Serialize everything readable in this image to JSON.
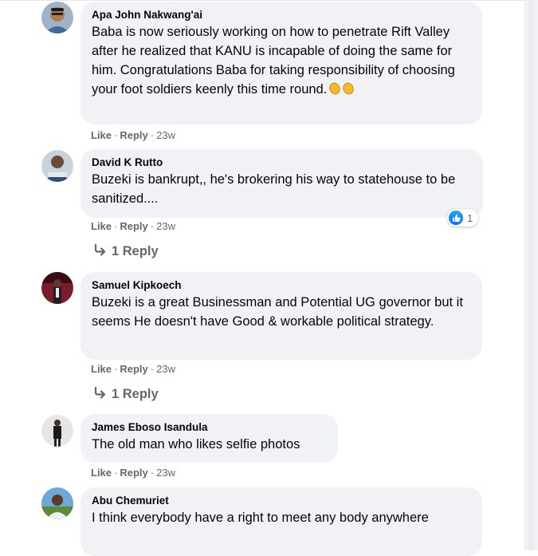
{
  "comments": [
    {
      "author": "Apa John Nakwang'ai",
      "text": "Baba is now seriously working on how to penetrate Rift Valley after he realized that KANU is incapable of doing the same for him. Congratulations Baba for taking responsibility of choosing your foot soldiers keenly this time round.",
      "emoji": "clapping-hands x2",
      "like": "Like",
      "reply": "Reply",
      "time": "23w"
    },
    {
      "author": "David K Rutto",
      "text": "Buzeki is bankrupt,, he's brokering his way to statehouse to be sanitized....",
      "like": "Like",
      "reply": "Reply",
      "time": "23w",
      "reaction_count": "1",
      "replies_label": "1 Reply"
    },
    {
      "author": "Samuel Kipkoech",
      "text": "Buzeki is a great Businessman and Potential UG governor but it seems He doesn't have Good & workable political strategy.",
      "like": "Like",
      "reply": "Reply",
      "time": "23w",
      "replies_label": "1 Reply"
    },
    {
      "author": "James Eboso Isandula",
      "text": "The old man who likes selfie photos",
      "like": "Like",
      "reply": "Reply",
      "time": "23w"
    },
    {
      "author": "Abu Chemuriet",
      "text": "I think everybody have a right to meet any body anywhere"
    }
  ],
  "colors": {
    "bubble": "#f0f2f5",
    "meta": "#65676b",
    "like_blue": "#0866ff"
  }
}
